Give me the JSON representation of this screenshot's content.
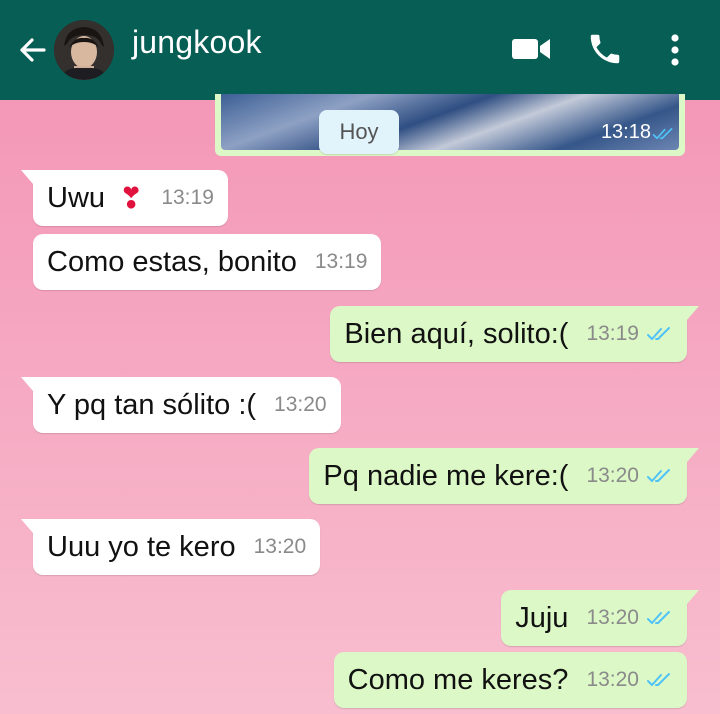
{
  "header": {
    "contact_name": "jungkook",
    "icons": [
      "back-arrow-icon",
      "video-call-icon",
      "phone-icon",
      "more-options-icon"
    ],
    "color": "#075e54"
  },
  "media_message": {
    "time": "13:18",
    "status": "read"
  },
  "date_chip": "Hoy",
  "messages": [
    {
      "direction": "incoming",
      "text": "Uwu",
      "emoji": "❣",
      "time": "13:19"
    },
    {
      "direction": "incoming",
      "text": "Como estas, bonito",
      "time": "13:19"
    },
    {
      "direction": "outgoing",
      "text": "Bien aquí, solito:(",
      "time": "13:19",
      "status": "read"
    },
    {
      "direction": "incoming",
      "text": "Y pq tan sólito :(",
      "time": "13:20"
    },
    {
      "direction": "outgoing",
      "text": "Pq nadie me kere:(",
      "time": "13:20",
      "status": "read"
    },
    {
      "direction": "incoming",
      "text": "Uuu yo te kero",
      "time": "13:20"
    },
    {
      "direction": "outgoing",
      "text": "Juju",
      "time": "13:20",
      "status": "read"
    },
    {
      "direction": "outgoing",
      "text": "Como me keres?",
      "time": "13:20",
      "status": "read"
    }
  ],
  "colors": {
    "incoming_bubble": "#ffffff",
    "outgoing_bubble": "#dcf8c6",
    "read_tick": "#4fc3f7",
    "background": "#f5a3bf"
  }
}
